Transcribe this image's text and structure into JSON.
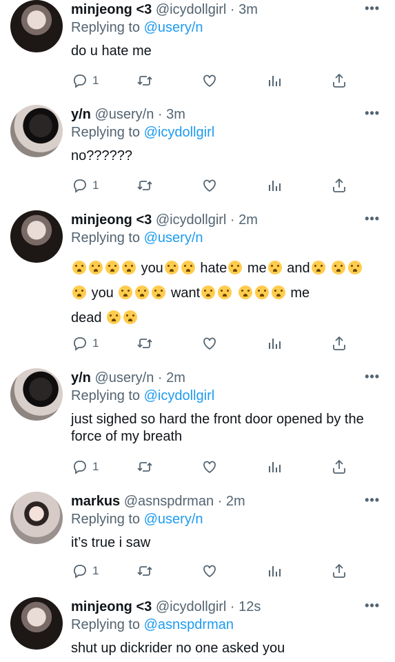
{
  "tweets": [
    {
      "name": "minjeong <3",
      "handle": "@icydollgirl",
      "time": "3m",
      "reply_prefix": "Replying to",
      "reply_to": "@usery/n",
      "text": "do u hate me",
      "reply_count": "1",
      "avatar": "minjeong"
    },
    {
      "name": "y/n",
      "handle": "@usery/n",
      "time": "3m",
      "reply_prefix": "Replying to",
      "reply_to": "@icydollgirl",
      "text": "no??????",
      "reply_count": "1",
      "avatar": "yn"
    },
    {
      "name": "minjeong <3",
      "handle": "@icydollgirl",
      "time": "2m",
      "reply_prefix": "Replying to",
      "reply_to": "@usery/n",
      "text_words": {
        "w1": "you",
        "w2": "hate",
        "w3": "me",
        "w4": "and",
        "w5": "you",
        "w6": "want",
        "w7": "me",
        "w8": "dead"
      },
      "reply_count": "1",
      "avatar": "minjeong"
    },
    {
      "name": "y/n",
      "handle": "@usery/n",
      "time": "2m",
      "reply_prefix": "Replying to",
      "reply_to": "@icydollgirl",
      "text": "just sighed so hard the front door opened by the force of my breath",
      "reply_count": "1",
      "avatar": "yn"
    },
    {
      "name": "markus",
      "handle": "@asnspdrman",
      "time": "2m",
      "reply_prefix": "Replying to",
      "reply_to": "@usery/n",
      "text": "it’s true i saw",
      "reply_count": "1",
      "avatar": "markus"
    },
    {
      "name": "minjeong <3",
      "handle": "@icydollgirl",
      "time": "12s",
      "reply_prefix": "Replying to",
      "reply_to": "@asnspdrman",
      "text": "shut up dickrider no one asked you",
      "avatar": "minjeong"
    }
  ],
  "separator": " · ",
  "more_label": "•••",
  "icons": {
    "reply": "reply-icon",
    "retweet": "retweet-icon",
    "like": "heart-icon",
    "views": "views-icon",
    "share": "share-icon"
  },
  "colors": {
    "link": "#1d9bf0",
    "secondary": "#536471",
    "text": "#0f1419"
  }
}
